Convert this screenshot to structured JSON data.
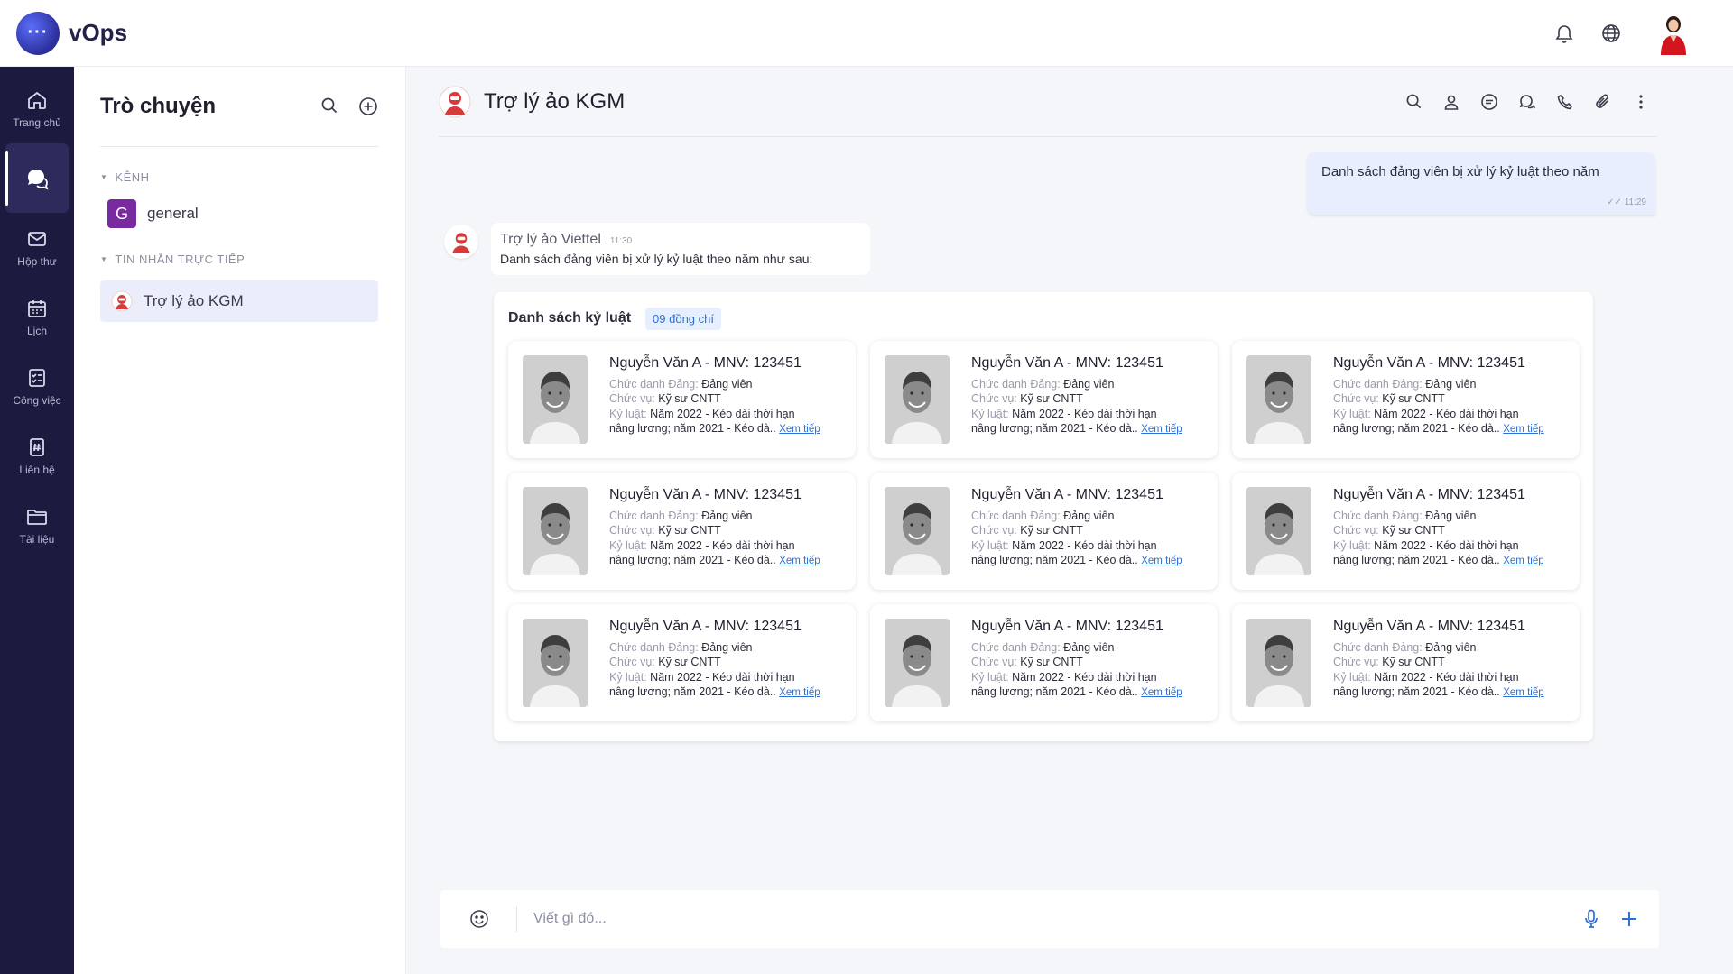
{
  "app": {
    "name": "vOps",
    "logo_glyph": "···"
  },
  "nav": [
    {
      "label": "Trang chủ",
      "icon": "home-icon"
    },
    {
      "label": "",
      "icon": "chat-icon",
      "active": true
    },
    {
      "label": "Hộp thư",
      "icon": "mail-icon"
    },
    {
      "label": "Lịch",
      "icon": "calendar-icon"
    },
    {
      "label": "Công việc",
      "icon": "task-icon"
    },
    {
      "label": "Liên hệ",
      "icon": "contacts-icon"
    },
    {
      "label": "Tài liệu",
      "icon": "folder-icon"
    }
  ],
  "sidebar": {
    "title": "Trò chuyện",
    "channels_label": "KÊNH",
    "channels": [
      {
        "badge": "G",
        "name": "general"
      }
    ],
    "direct_label": "TIN NHẮN TRỰC TIẾP",
    "direct": [
      {
        "name": "Trợ lý ảo KGM"
      }
    ]
  },
  "chat": {
    "title": "Trợ lý ảo KGM",
    "outgoing": {
      "text": "Danh sách đảng viên bị xử lý kỷ luật theo năm",
      "time": "11:29"
    },
    "incoming": {
      "sender": "Trợ lý ảo Viettel",
      "time": "11:30",
      "text": "Danh sách đảng viên bị xử lý kỷ luật theo năm như sau:"
    },
    "list": {
      "title": "Danh sách kỷ luật",
      "count": "09 đồng chí",
      "people": [
        {
          "name": "Nguyễn Văn A - MNV: 123451",
          "role_label": "Chức danh Đảng:",
          "role": "Đảng viên",
          "position_label": "Chức vụ:",
          "position": "Kỹ sư CNTT",
          "discipline_label": "Kỷ luật:",
          "discipline_1": "Năm 2022 - Kéo dài thời hạn",
          "discipline_2": "nâng lương; năm 2021 - Kéo dà..",
          "more": "Xem tiếp"
        },
        {
          "name": "Nguyễn Văn A - MNV: 123451",
          "role_label": "Chức danh Đảng:",
          "role": "Đảng viên",
          "position_label": "Chức vụ:",
          "position": "Kỹ sư CNTT",
          "discipline_label": "Kỷ luật:",
          "discipline_1": "Năm 2022 - Kéo dài thời hạn",
          "discipline_2": "nâng lương; năm 2021 - Kéo dà..",
          "more": "Xem tiếp"
        },
        {
          "name": "Nguyễn Văn A - MNV: 123451",
          "role_label": "Chức danh Đảng:",
          "role": "Đảng viên",
          "position_label": "Chức vụ:",
          "position": "Kỹ sư CNTT",
          "discipline_label": "Kỷ luật:",
          "discipline_1": "Năm 2022 - Kéo dài thời hạn",
          "discipline_2": "nâng lương; năm 2021 - Kéo dà..",
          "more": "Xem tiếp"
        },
        {
          "name": "Nguyễn Văn A - MNV: 123451",
          "role_label": "Chức danh Đảng:",
          "role": "Đảng viên",
          "position_label": "Chức vụ:",
          "position": "Kỹ sư CNTT",
          "discipline_label": "Kỷ luật:",
          "discipline_1": "Năm 2022 - Kéo dài thời hạn",
          "discipline_2": "nâng lương; năm 2021 - Kéo dà..",
          "more": "Xem tiếp"
        },
        {
          "name": "Nguyễn Văn A - MNV: 123451",
          "role_label": "Chức danh Đảng:",
          "role": "Đảng viên",
          "position_label": "Chức vụ:",
          "position": "Kỹ sư CNTT",
          "discipline_label": "Kỷ luật:",
          "discipline_1": "Năm 2022 - Kéo dài thời hạn",
          "discipline_2": "nâng lương; năm 2021 - Kéo dà..",
          "more": "Xem tiếp"
        },
        {
          "name": "Nguyễn Văn A - MNV: 123451",
          "role_label": "Chức danh Đảng:",
          "role": "Đảng viên",
          "position_label": "Chức vụ:",
          "position": "Kỹ sư CNTT",
          "discipline_label": "Kỷ luật:",
          "discipline_1": "Năm 2022 - Kéo dài thời hạn",
          "discipline_2": "nâng lương; năm 2021 - Kéo dà..",
          "more": "Xem tiếp"
        },
        {
          "name": "Nguyễn Văn A - MNV: 123451",
          "role_label": "Chức danh Đảng:",
          "role": "Đảng viên",
          "position_label": "Chức vụ:",
          "position": "Kỹ sư CNTT",
          "discipline_label": "Kỷ luật:",
          "discipline_1": "Năm 2022 - Kéo dài thời hạn",
          "discipline_2": "nâng lương; năm 2021 - Kéo dà..",
          "more": "Xem tiếp"
        },
        {
          "name": "Nguyễn Văn A - MNV: 123451",
          "role_label": "Chức danh Đảng:",
          "role": "Đảng viên",
          "position_label": "Chức vụ:",
          "position": "Kỹ sư CNTT",
          "discipline_label": "Kỷ luật:",
          "discipline_1": "Năm 2022 - Kéo dài thời hạn",
          "discipline_2": "nâng lương; năm 2021 - Kéo dà..",
          "more": "Xem tiếp"
        },
        {
          "name": "Nguyễn Văn A - MNV: 123451",
          "role_label": "Chức danh Đảng:",
          "role": "Đảng viên",
          "position_label": "Chức vụ:",
          "position": "Kỹ sư CNTT",
          "discipline_label": "Kỷ luật:",
          "discipline_1": "Năm 2022 - Kéo dài thời hạn",
          "discipline_2": "nâng lương; năm 2021 - Kéo dà..",
          "more": "Xem tiếp"
        }
      ]
    },
    "composer": {
      "placeholder": "Viết gì đó..."
    }
  },
  "colors": {
    "rail": "#1c1b3f",
    "accent": "#2f6fd6",
    "channel_badge": "#7a2aa0",
    "outgoing_bubble": "#e9eeff"
  }
}
